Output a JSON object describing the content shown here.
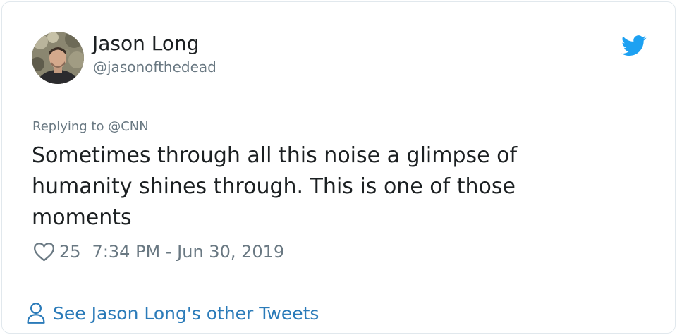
{
  "tweet": {
    "author": {
      "name": "Jason Long",
      "handle": "@jasonofthedead"
    },
    "reply_context": "Replying to @CNN",
    "text": "Sometimes through all this noise a glimpse of humanity shines through. This is one of those moments",
    "like_count": "25",
    "timestamp": "7:34 PM - Jun 30, 2019"
  },
  "footer": {
    "link_label": "See Jason Long's other Tweets"
  },
  "icons": {
    "brand": "twitter-bird-icon",
    "like": "heart-icon",
    "profile": "person-icon"
  },
  "colors": {
    "twitter_blue": "#1da1f2",
    "link_blue": "#2b7bb9",
    "text_primary": "#1c2022",
    "text_secondary": "#697882",
    "border": "#e1e8ed"
  }
}
